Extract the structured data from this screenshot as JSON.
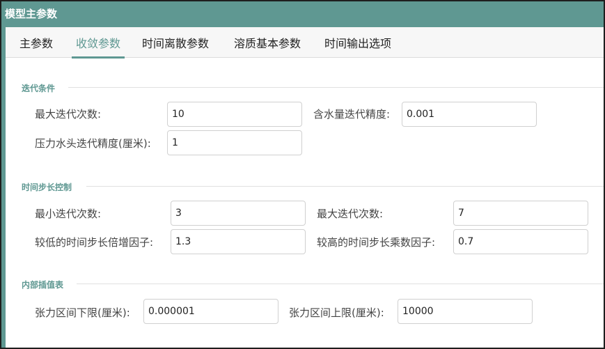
{
  "window": {
    "title": "模型主参数"
  },
  "tabs": [
    {
      "label": "主参数"
    },
    {
      "label": "收敛参数"
    },
    {
      "label": "时间离散参数"
    },
    {
      "label": "溶质基本参数"
    },
    {
      "label": "时间输出选项"
    }
  ],
  "active_tab": "收敛参数",
  "sections": {
    "iteration": {
      "title": "迭代条件",
      "max_iter_label": "最大迭代次数:",
      "max_iter_value": "10",
      "water_tol_label": "含水量迭代精度:",
      "water_tol_value": "0.001",
      "head_tol_label": "压力水头迭代精度(厘米):",
      "head_tol_value": "1"
    },
    "timestep": {
      "title": "时间步长控制",
      "min_iter_label": "最小迭代次数:",
      "min_iter_value": "3",
      "max_iter_label": "最大迭代次数:",
      "max_iter_value": "7",
      "low_factor_label": "较低的时间步长倍增因子:",
      "low_factor_value": "1.3",
      "high_factor_label": "较高的时间步长乘数因子:",
      "high_factor_value": "0.7"
    },
    "interp": {
      "title": "内部插值表",
      "lower_label": "张力区间下限(厘米):",
      "lower_value": "0.000001",
      "upper_label": "张力区间上限(厘米):",
      "upper_value": "10000"
    }
  },
  "colors": {
    "accent": "#5f9892",
    "border": "#1e1e1e"
  }
}
